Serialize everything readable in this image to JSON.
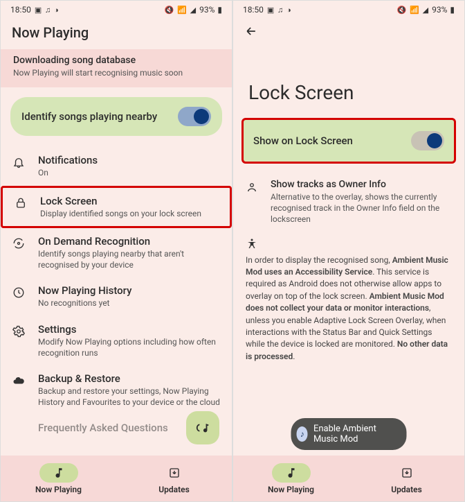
{
  "status": {
    "time": "18:50",
    "battery": "93%"
  },
  "left": {
    "header": "Now Playing",
    "banner": {
      "title": "Downloading song database",
      "sub": "Now Playing will start recognising music soon"
    },
    "identify": "Identify songs playing nearby",
    "items": [
      {
        "t": "Notifications",
        "s": "On"
      },
      {
        "t": "Lock Screen",
        "s": "Display identified songs on your lock screen"
      },
      {
        "t": "On Demand Recognition",
        "s": "Identify songs playing nearby that aren't recognised by your device"
      },
      {
        "t": "Now Playing History",
        "s": "No recognitions yet"
      },
      {
        "t": "Settings",
        "s": "Modify Now Playing options including how often recognition runs"
      },
      {
        "t": "Backup & Restore",
        "s": "Backup and restore your settings, Now Playing History and Favourites to your device or the cloud"
      },
      {
        "t": "Frequently Asked Questions",
        "s": ""
      }
    ],
    "nav": {
      "a": "Now Playing",
      "b": "Updates"
    }
  },
  "right": {
    "title": "Lock Screen",
    "toggle_label": "Show on Lock Screen",
    "owner": {
      "t": "Show tracks as Owner Info",
      "s": "Alternative to the overlay, shows the currently recognised track in the Owner Info field on the lockscreen"
    },
    "para_pre": "In order to display the recognised song, ",
    "para_b1": "Ambient Music Mod uses an Accessibility Service",
    "para_mid1": ". This service is required as Android does not otherwise allow apps to overlay on top of the lock screen. ",
    "para_b2": "Ambient Music Mod does not collect your data or monitor interactions",
    "para_mid2": ", unless you enable Adaptive Lock Screen Overlay, when interactions with the Status Bar and Quick Settings while the device is locked are monitored. ",
    "para_b3": "No other data is processed",
    "para_end": ".",
    "chip": "Enable Ambient Music Mod",
    "nav": {
      "a": "Now Playing",
      "b": "Updates"
    }
  }
}
